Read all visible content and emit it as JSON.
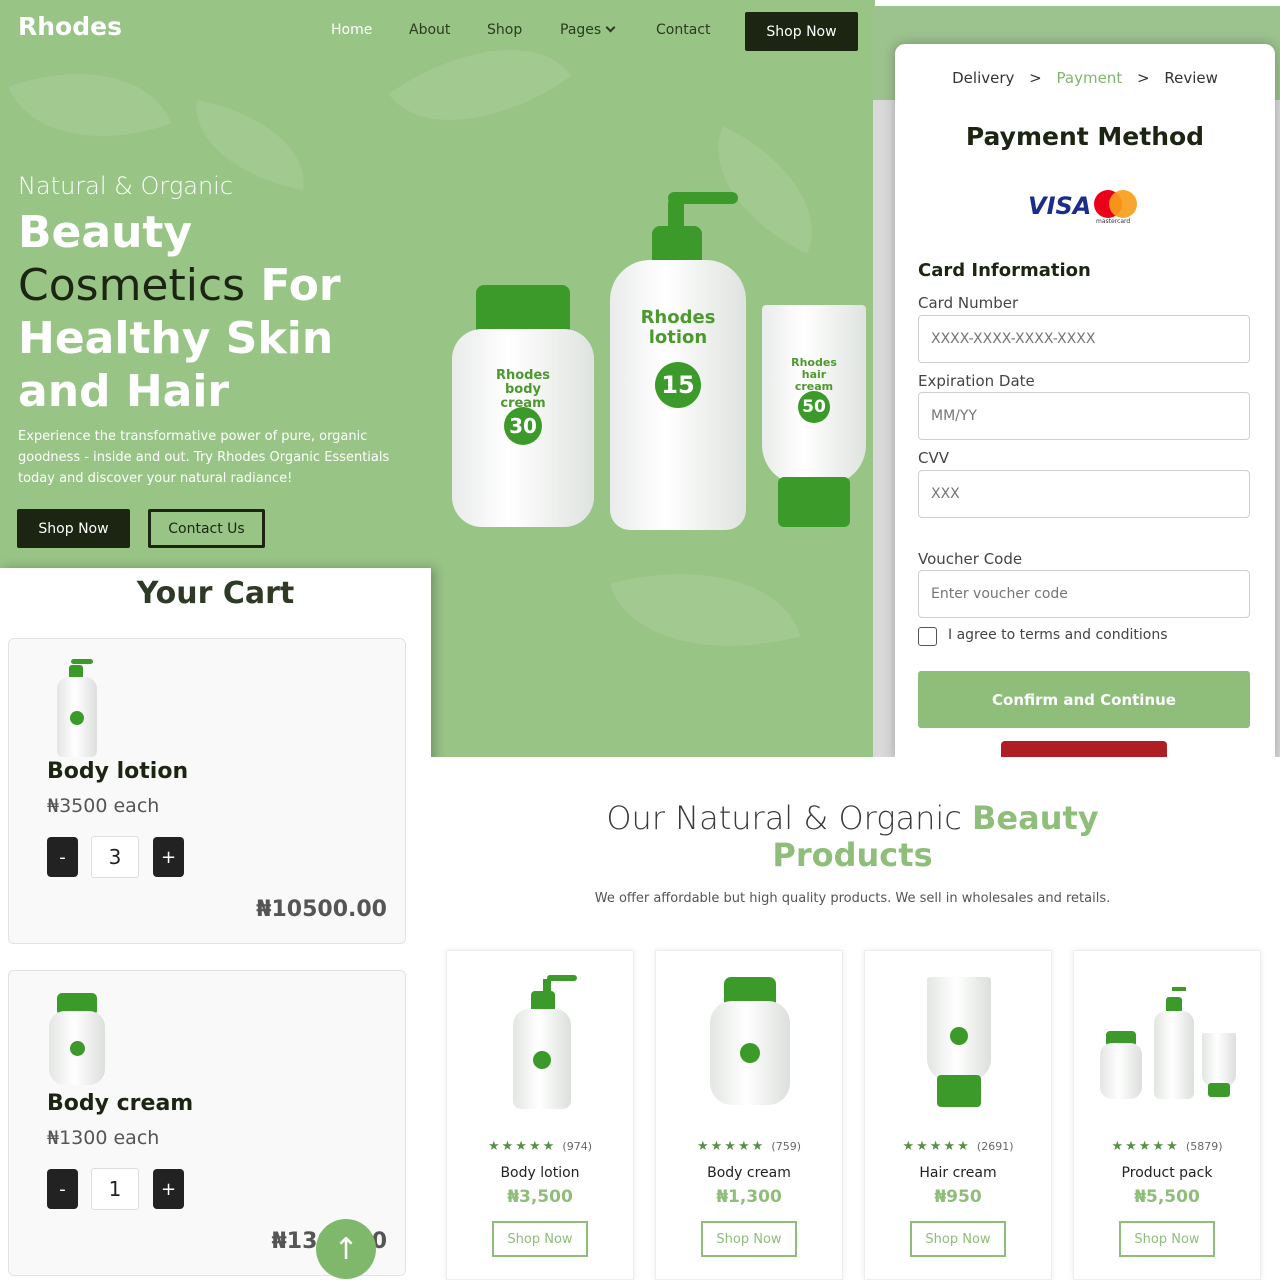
{
  "hero": {
    "brand": "Rhodes",
    "nav": {
      "home": "Home",
      "about": "About",
      "shop": "Shop",
      "pages": "Pages",
      "contact": "Contact"
    },
    "header_button": "Shop Now",
    "kicker": "Natural & Organic",
    "headline_1": "Beauty",
    "headline_2_light": "Cosmetics",
    "headline_2_bold": "For",
    "headline_3": "Healthy Skin and Hair",
    "description": "Experience the transformative power of pure, organic goodness - inside and out. Try Rhodes Organic Essentials today and discover your natural radiance!",
    "primary_button": "Shop Now",
    "secondary_button": "Contact Us",
    "bottles": [
      {
        "label": "Rhodes body cream",
        "spf": "30"
      },
      {
        "label": "Rhodes lotion",
        "spf": "15"
      },
      {
        "label": "Rhodes hair cream",
        "spf": "50"
      }
    ]
  },
  "payment": {
    "steps": {
      "delivery": "Delivery",
      "payment": "Payment",
      "review": "Review",
      "sep": ">"
    },
    "title": "Payment Method",
    "visa": "VISA",
    "mastercard": "mastercard",
    "card_info_heading": "Card Information",
    "card_number_label": "Card Number",
    "card_number_placeholder": "XXXX-XXXX-XXXX-XXXX",
    "expiry_label": "Expiration Date",
    "expiry_placeholder": "MM/YY",
    "cvv_label": "CVV",
    "cvv_placeholder": "XXX",
    "voucher_label": "Voucher Code",
    "voucher_placeholder": "Enter voucher code",
    "terms": "I agree to terms and conditions",
    "confirm_button": "Confirm and Continue"
  },
  "cart": {
    "title": "Your Cart",
    "items": [
      {
        "name": "Body lotion",
        "price": "₦3500 each",
        "qty": "3",
        "total": "₦10500.00",
        "minus": "-",
        "plus": "+"
      },
      {
        "name": "Body cream",
        "price": "₦1300 each",
        "qty": "1",
        "total": "₦1300.00",
        "minus": "-",
        "plus": "+"
      }
    ],
    "scroll_top_icon": "↑"
  },
  "products": {
    "heading_light": "Our Natural & Organic",
    "heading_accent_1": "Beauty",
    "heading_accent_2": "Products",
    "subtitle": "We offer affordable but high quality products. We sell in wholesales and retails.",
    "stars": "★★★★★",
    "items": [
      {
        "name": "Body lotion",
        "count": "(974)",
        "price": "₦3,500",
        "button": "Shop Now"
      },
      {
        "name": "Body cream",
        "count": "(759)",
        "price": "₦1,300",
        "button": "Shop Now"
      },
      {
        "name": "Hair cream",
        "count": "(2691)",
        "price": "₦950",
        "button": "Shop Now"
      },
      {
        "name": "Product pack",
        "count": "(5879)",
        "price": "₦5,500",
        "button": "Shop Now"
      }
    ]
  },
  "colors": {
    "brand_green": "#8ebe7a",
    "hero_bg": "#98c486",
    "dark": "#1b2512",
    "bottle_green": "#3c9a2a"
  }
}
